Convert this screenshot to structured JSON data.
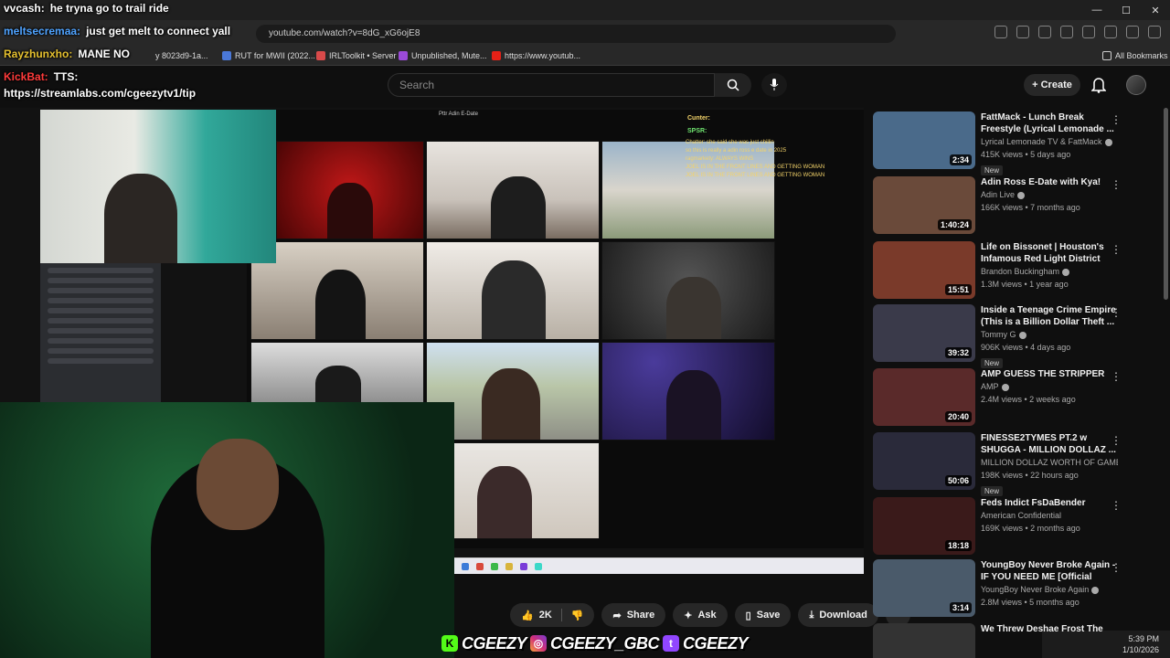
{
  "window": {
    "minimize": "—",
    "maximize": "☐",
    "close": "✕"
  },
  "browser": {
    "url": "youtube.com/watch?v=8dG_xG6ojE8",
    "bookmarks": [
      {
        "label": "RUT for MWII (2022..."
      },
      {
        "label": "IRLToolkit • Server"
      },
      {
        "label": "Unpublished, Mute..."
      },
      {
        "label": "https://www.youtub..."
      },
      {
        "label": "All Bookmarks"
      }
    ],
    "bookmark_partial": "y 8023d9-1a..."
  },
  "youtube": {
    "search_placeholder": "Search",
    "create_label": "Create"
  },
  "overlay": {
    "chat": [
      {
        "name": "vvcash:",
        "text": "he tryna go to trail ride",
        "color": "#ffffff"
      },
      {
        "name": "meltsecremaa:",
        "text": "just get melt to connect yall",
        "color": "#4fa3ff"
      },
      {
        "name": "Rayzhunxho:",
        "text": "MANE NO",
        "color": "#e6c12f"
      },
      {
        "name": "KickBat:",
        "text": "TTS:",
        "color": "#ff3b3b"
      }
    ],
    "tts_link": "https://streamlabs.com/cgeezytv1/tip",
    "game_title": "Pttr Adin E-Date",
    "counter_label": "Cunter:",
    "spsr_label": "SPSR:",
    "stream_chat": [
      "Chatter: she said she was just chillin",
      "so this is really a adin ross e date in 2025",
      "ragmarkety: ALWAYS WINS",
      "JOEL IS IN THE FRONT LINES AND GETTING WOMAN",
      "JOEL IS IN THE FRONT LINES AND GETTING WOMAN"
    ]
  },
  "discord": {
    "rows": [
      "rejoin # glitched out M",
      "rejoin # glitched out M",
      "Main Round",
      "Second Round",
      "Final Round",
      "adin",
      "chiba",
      "Coffee",
      "rejoin2024",
      "ali prime",
      "Kai Cenat"
    ]
  },
  "actions": {
    "like_count": "2K",
    "share": "Share",
    "ask": "Ask",
    "save": "Save",
    "download": "Download"
  },
  "socials": {
    "kick": "CGEEZY",
    "instagram": "CGEEZY_GBC",
    "twitch": "CGEEZY"
  },
  "clock": {
    "time": "5:39 PM",
    "date": "1/10/2026"
  },
  "recommendations": [
    {
      "title": "FattMack - Lunch Break Freestyle (Lyrical Lemonade ...",
      "channel": "Lyrical Lemonade TV & FattMack",
      "stats": "415K views • 5 days ago",
      "badge": "New",
      "duration": "2:34",
      "thumb": "#4a6a8a"
    },
    {
      "title": "Adin Ross E-Date with Kya!",
      "channel": "Adin Live",
      "stats": "166K views • 7 months ago",
      "badge": "",
      "duration": "1:40:24",
      "thumb": "#6a4a3a"
    },
    {
      "title": "Life on Bissonet | Houston's Infamous Red Light District",
      "channel": "Brandon Buckingham",
      "stats": "1.3M views • 1 year ago",
      "badge": "",
      "duration": "15:51",
      "thumb": "#7a3a2a"
    },
    {
      "title": "Inside a Teenage Crime Empire (This is a Billion Dollar Theft ...",
      "channel": "Tommy G",
      "stats": "906K views • 4 days ago",
      "badge": "New",
      "duration": "39:32",
      "thumb": "#3a3a4a"
    },
    {
      "title": "AMP GUESS THE STRIPPER",
      "channel": "AMP",
      "stats": "2.4M views • 2 weeks ago",
      "badge": "",
      "duration": "20:40",
      "thumb": "#5a2a2a"
    },
    {
      "title": "FINESSE2TYMES PT.2 w SHUGGA - MILLION DOLLAZ ...",
      "channel": "MILLION DOLLAZ WORTH OF GAME",
      "stats": "198K views • 22 hours ago",
      "badge": "New",
      "duration": "50:06",
      "thumb": "#2a2a3a"
    },
    {
      "title": "Feds Indict FsDaBender",
      "channel": "American Confidential",
      "stats": "169K views • 2 months ago",
      "badge": "",
      "duration": "18:18",
      "thumb": "#3a1a1a"
    },
    {
      "title": "YoungBoy Never Broke Again - IF YOU NEED ME [Official Audio]",
      "channel": "YoungBoy Never Broke Again",
      "stats": "2.8M views • 5 months ago",
      "badge": "",
      "duration": "3:14",
      "thumb": "#4a5a6a"
    },
    {
      "title": "We Threw Deshae Frost The",
      "channel": "",
      "stats": "",
      "badge": "",
      "duration": "",
      "thumb": "#333"
    }
  ]
}
